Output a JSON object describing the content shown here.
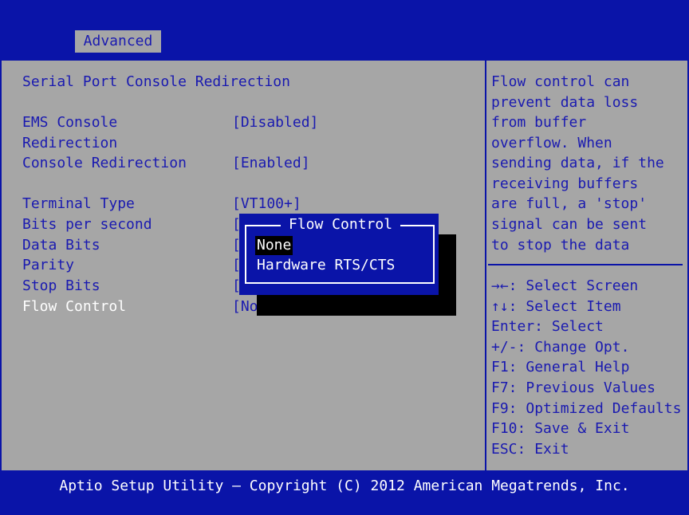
{
  "header": {
    "active_tab": "Advanced"
  },
  "main": {
    "section_title": "Serial Port Console Redirection",
    "settings": [
      {
        "label": "EMS Console",
        "label2": "Redirection",
        "value": "[Disabled]"
      },
      {
        "label": "Console Redirection",
        "value": "[Enabled]"
      },
      {
        "label": "Terminal Type",
        "value": "[VT100+]"
      },
      {
        "label": "Bits per second",
        "value": "["
      },
      {
        "label": "Data Bits",
        "value": "["
      },
      {
        "label": "Parity",
        "value": "["
      },
      {
        "label": "Stop Bits",
        "value": "["
      },
      {
        "label": "Flow Control",
        "value": "[No"
      }
    ]
  },
  "popup": {
    "title": "Flow Control",
    "options": [
      "None",
      "Hardware RTS/CTS"
    ],
    "selected": "None"
  },
  "help": {
    "description": [
      "Flow control can",
      "prevent data loss",
      "from buffer",
      "overflow. When",
      "sending data, if the",
      "receiving buffers",
      "are full, a 'stop'",
      "signal can be sent",
      "to stop the data"
    ],
    "keys": [
      {
        "key": "→←:",
        "action": "Select Screen"
      },
      {
        "key": "↑↓:",
        "action": "Select Item"
      },
      {
        "key": "Enter:",
        "action": "Select"
      },
      {
        "key": "+/-:",
        "action": "Change Opt."
      },
      {
        "key": "F1:",
        "action": "General Help"
      },
      {
        "key": "F7:",
        "action": "Previous Values"
      },
      {
        "key": "F9:",
        "action": "Optimized Defaults"
      },
      {
        "key": "F10:",
        "action": "Save & Exit"
      },
      {
        "key": "ESC:",
        "action": "Exit"
      }
    ]
  },
  "footer": {
    "text": "Aptio Setup Utility – Copyright (C) 2012 American Megatrends, Inc."
  },
  "colors": {
    "background_blue": "#0a14a8",
    "panel_gray": "#a6a6a6",
    "text_blue": "#1a1ab0",
    "highlight_white": "#ffffff"
  }
}
